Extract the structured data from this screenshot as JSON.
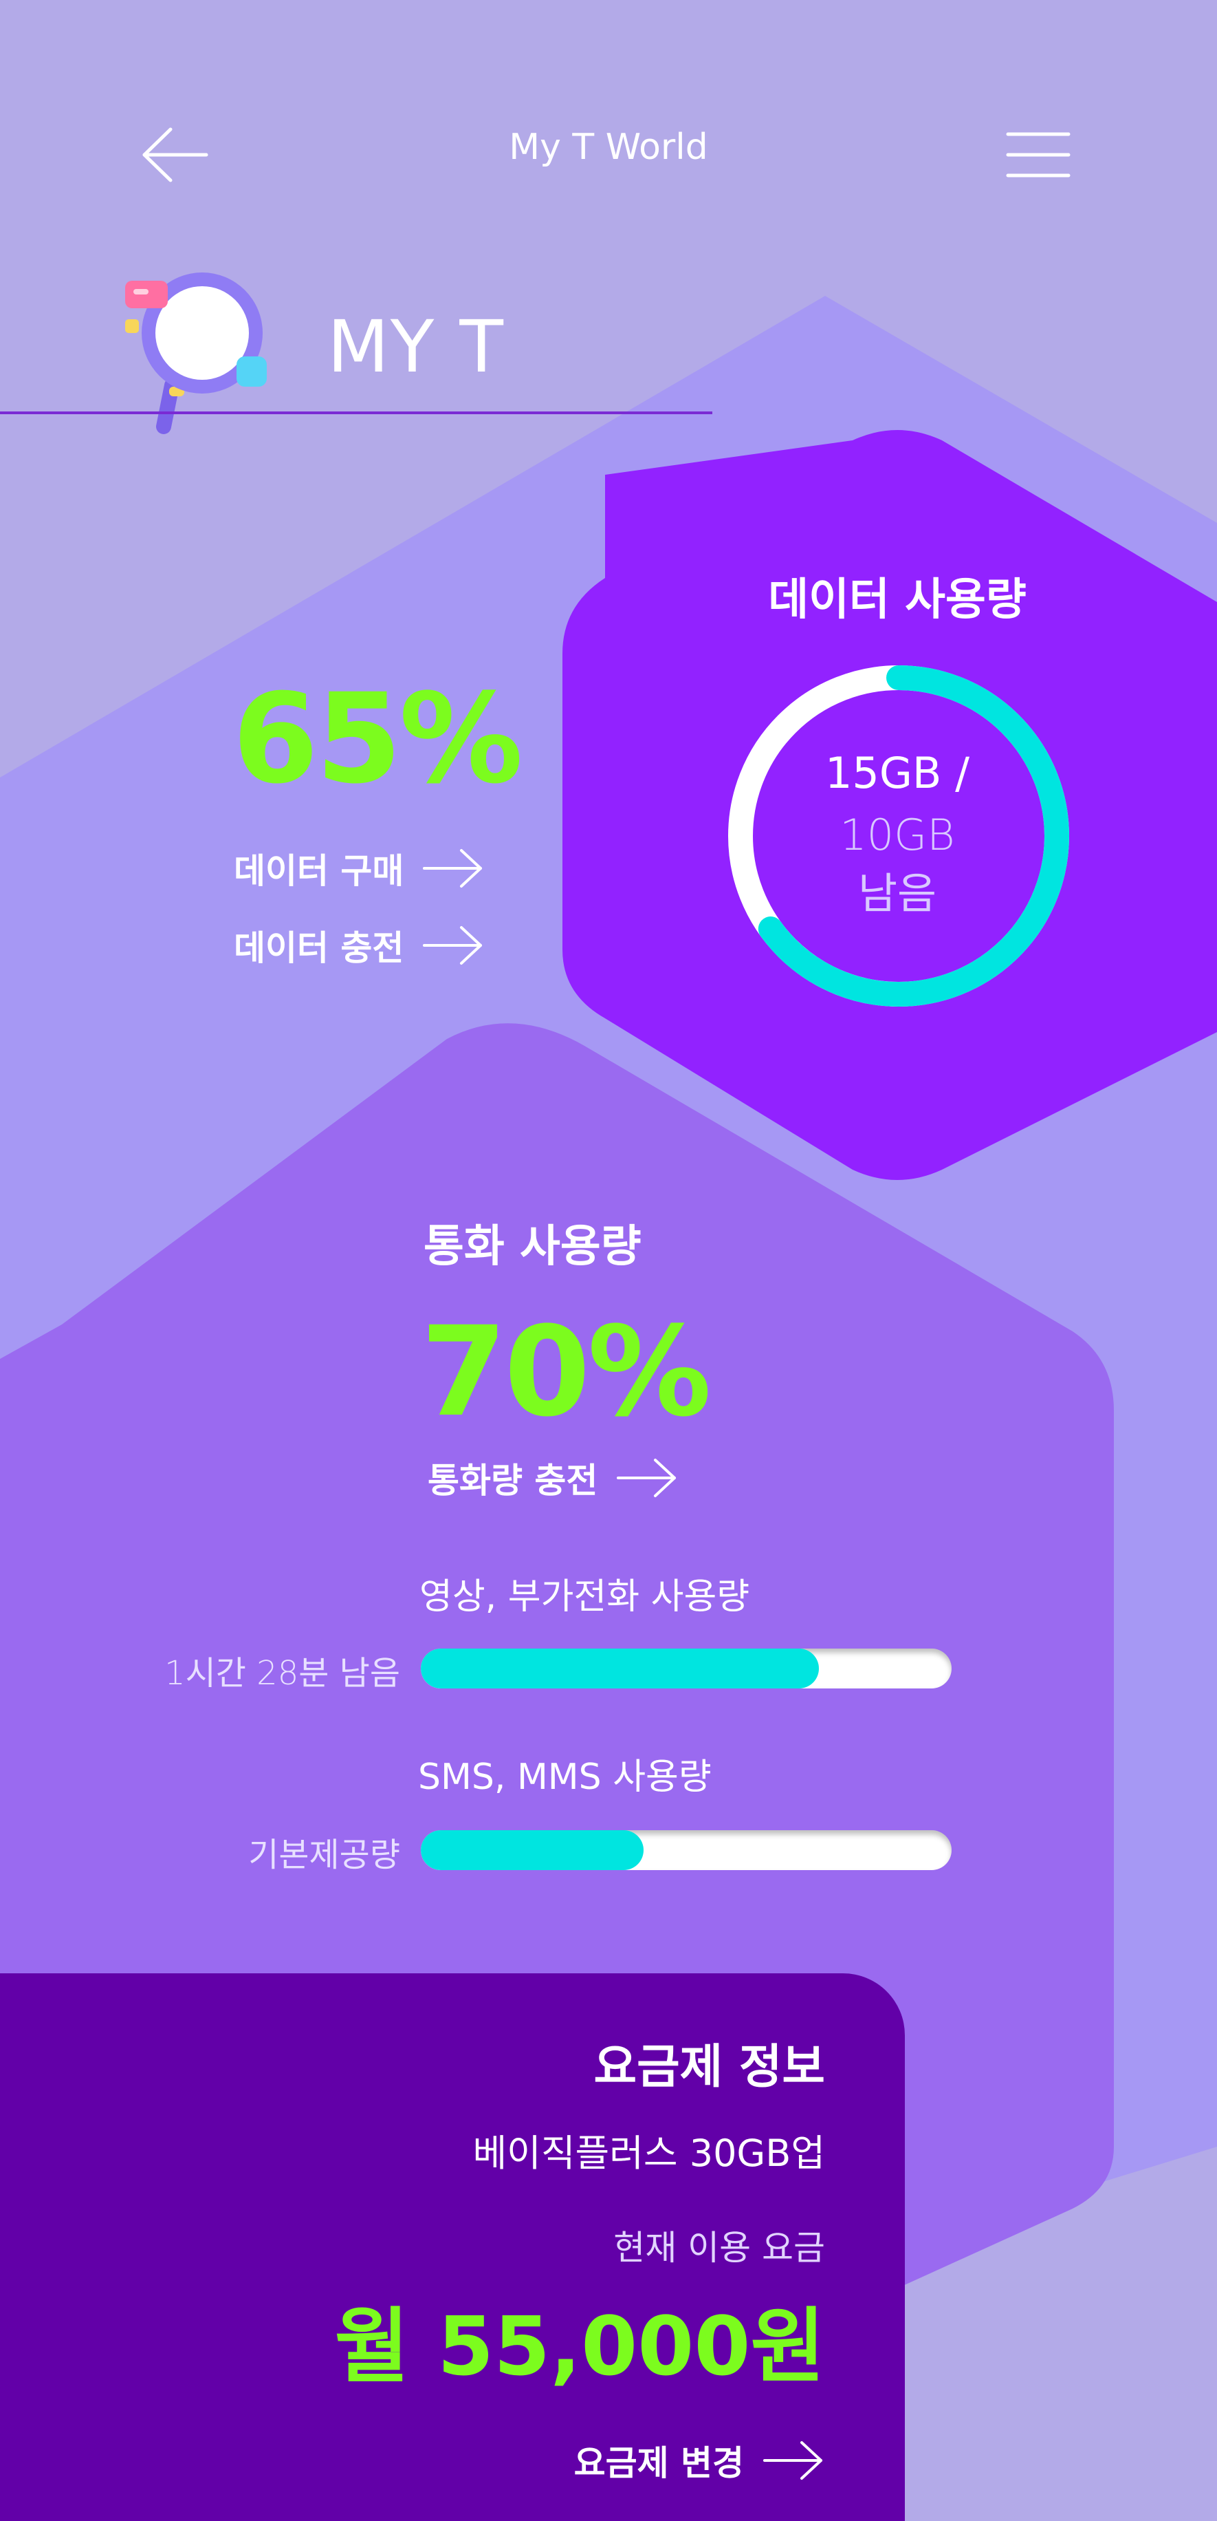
{
  "header": {
    "title": "My T World",
    "back_icon": "arrow-left-icon",
    "menu_icon": "hamburger-menu-icon"
  },
  "brand": {
    "title": "MY T",
    "icon": "magnifier-illustration-icon"
  },
  "data_usage": {
    "title": "데이터 사용량",
    "percent": "65%",
    "buy_label": "데이터 구매",
    "charge_label": "데이터 충전",
    "ring_line1": "15GB /",
    "ring_line2": "10GB",
    "ring_line3": "남음",
    "ring_fill_fraction": 0.65
  },
  "call_usage": {
    "title": "통화 사용량",
    "percent": "70%",
    "charge_label": "통화량 충전",
    "video": {
      "label": "영상, 부가전화 사용량",
      "remaining": "1시간 28분 남음",
      "fill_percent": 75
    },
    "sms": {
      "label": "SMS, MMS 사용량",
      "remaining": "기본제공량",
      "fill_percent": 42
    }
  },
  "plan": {
    "title": "요금제 정보",
    "name": "베이직플러스 30GB업",
    "current_label": "현재 이용 요금",
    "current_fee": "월 55,000원",
    "change_label": "요금제 변경"
  },
  "colors": {
    "background": "#b3aae8",
    "accent_green": "#7cfc1e",
    "accent_cyan": "#00e5e0",
    "data_hex": "#9222ff",
    "plan_card": "#6200a8"
  }
}
